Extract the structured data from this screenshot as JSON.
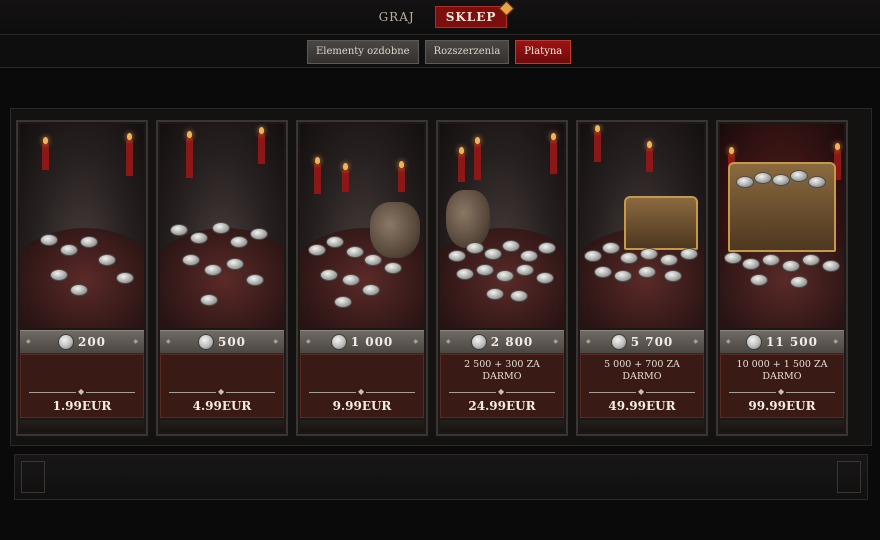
{
  "nav": {
    "play_label": "GRAJ",
    "shop_label": "SKLEP"
  },
  "tabs": [
    {
      "label": "Elementy ozdobne",
      "active": false
    },
    {
      "label": "Rozszerzenia",
      "active": false
    },
    {
      "label": "Platyna",
      "active": true
    }
  ],
  "offers": [
    {
      "amount": "200",
      "bonus": "",
      "price": "1.99EUR"
    },
    {
      "amount": "500",
      "bonus": "",
      "price": "4.99EUR"
    },
    {
      "amount": "1 000",
      "bonus": "",
      "price": "9.99EUR"
    },
    {
      "amount": "2 800",
      "bonus": "2 500 + 300 ZA DARMO",
      "price": "24.99EUR"
    },
    {
      "amount": "5 700",
      "bonus": "5 000 + 700 ZA DARMO",
      "price": "49.99EUR"
    },
    {
      "amount": "11 500",
      "bonus": "10 000 + 1 500 ZA DARMO",
      "price": "99.99EUR"
    }
  ],
  "colors": {
    "accent_red": "#7c0e0e",
    "tab_active": "#9c1414",
    "info_bg": "#3a1a14"
  },
  "icons": {
    "currency": "platinum-coin-icon"
  }
}
